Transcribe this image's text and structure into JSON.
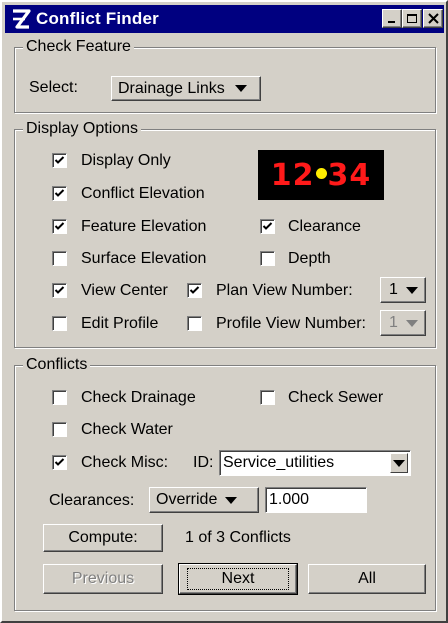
{
  "window": {
    "title": "Conflict Finder",
    "icon": "app-logo-icon"
  },
  "check_feature": {
    "legend": "Check Feature",
    "select_label": "Select:",
    "select_value": "Drainage Links"
  },
  "display_options": {
    "legend": "Display Options",
    "display_only": {
      "label": "Display Only",
      "checked": true
    },
    "conflict_elevation": {
      "label": "Conflict Elevation",
      "checked": true
    },
    "feature_elevation": {
      "label": "Feature Elevation",
      "checked": true
    },
    "clearance": {
      "label": "Clearance",
      "checked": true
    },
    "surface_elevation": {
      "label": "Surface Elevation",
      "checked": false
    },
    "depth": {
      "label": "Depth",
      "checked": false
    },
    "view_center": {
      "label": "View Center",
      "checked": true
    },
    "plan_view_number": {
      "label": "Plan View Number:",
      "checked": true,
      "value": "1"
    },
    "edit_profile": {
      "label": "Edit Profile",
      "checked": false
    },
    "profile_view_number": {
      "label": "Profile View Number:",
      "checked": false,
      "value": "1"
    },
    "clock": {
      "hours": "12",
      "minutes": "34"
    }
  },
  "conflicts": {
    "legend": "Conflicts",
    "check_drainage": {
      "label": "Check Drainage",
      "checked": false
    },
    "check_sewer": {
      "label": "Check Sewer",
      "checked": false
    },
    "check_water": {
      "label": "Check Water",
      "checked": false
    },
    "check_misc": {
      "label": "Check Misc:",
      "checked": true
    },
    "id_label": "ID:",
    "id_value": "Service_utilities",
    "clearances_label": "Clearances:",
    "clearances_mode": "Override",
    "clearances_value": "1.000",
    "compute_label": "Compute:",
    "status": "1 of 3 Conflicts",
    "previous_label": "Previous",
    "next_label": "Next",
    "all_label": "All"
  }
}
